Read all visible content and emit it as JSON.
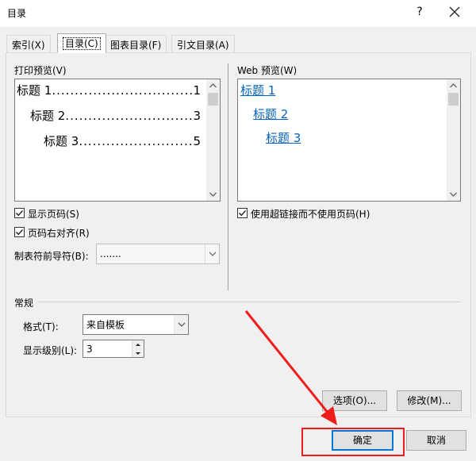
{
  "window": {
    "title": "目录",
    "help_glyph": "?",
    "close_icon": "close-icon"
  },
  "tabs": [
    {
      "label": "索引(X)",
      "active": false
    },
    {
      "label": "目录(C)",
      "active": true
    },
    {
      "label": "图表目录(F)",
      "active": false
    },
    {
      "label": "引文目录(A)",
      "active": false
    }
  ],
  "print_preview": {
    "label": "打印预览(V)",
    "entries": [
      {
        "title": "标题 1",
        "page": "1"
      },
      {
        "title": "标题 2",
        "page": "3"
      },
      {
        "title": "标题 3",
        "page": "5"
      }
    ]
  },
  "web_preview": {
    "label": "Web 预览(W)",
    "links": [
      "标题 1",
      "标题 2",
      "标题 3"
    ]
  },
  "options": {
    "show_page_numbers": {
      "label": "显示页码(S)",
      "checked": true
    },
    "right_align": {
      "label": "页码右对齐(R)",
      "checked": true
    },
    "use_hyperlinks": {
      "label": "使用超链接而不使用页码(H)",
      "checked": true
    },
    "tab_leader": {
      "label": "制表符前导符(B):",
      "value": "......."
    }
  },
  "general": {
    "heading": "常规",
    "format": {
      "label": "格式(T):",
      "value": "来自模板"
    },
    "levels": {
      "label": "显示级别(L):",
      "value": "3"
    }
  },
  "buttons": {
    "options": "选项(O)...",
    "modify": "修改(M)...",
    "ok": "确定",
    "cancel": "取消"
  },
  "annotation_color": "#ee1d1d",
  "link_color": "#0563c1"
}
